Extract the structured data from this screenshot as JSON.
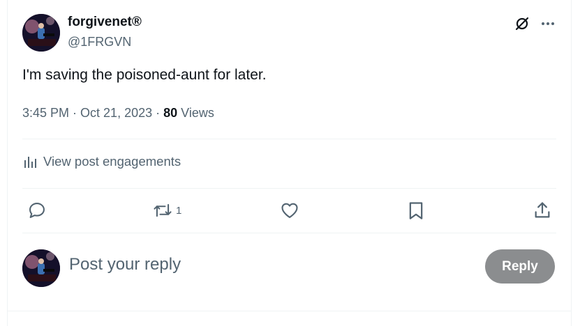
{
  "post": {
    "author_name": "forgivenet®",
    "author_handle": "@1FRGVN",
    "text": "I'm saving the poisoned-aunt for later.",
    "time": "3:45 PM",
    "date": "Oct 21, 2023",
    "separator": "·",
    "view_count": "80",
    "views_label": "Views"
  },
  "engagements": {
    "label": "View post engagements"
  },
  "actions": {
    "reply_icon": "comment-icon",
    "repost_icon": "repost-icon",
    "repost_count": "1",
    "like_icon": "heart-icon",
    "bookmark_icon": "bookmark-icon",
    "share_icon": "share-icon"
  },
  "composer": {
    "placeholder": "Post your reply",
    "reply_button": "Reply"
  },
  "colors": {
    "text_primary": "#0f1419",
    "text_secondary": "#536471",
    "divider": "#eff3f4",
    "reply_button_disabled": "#8b8d8f"
  }
}
